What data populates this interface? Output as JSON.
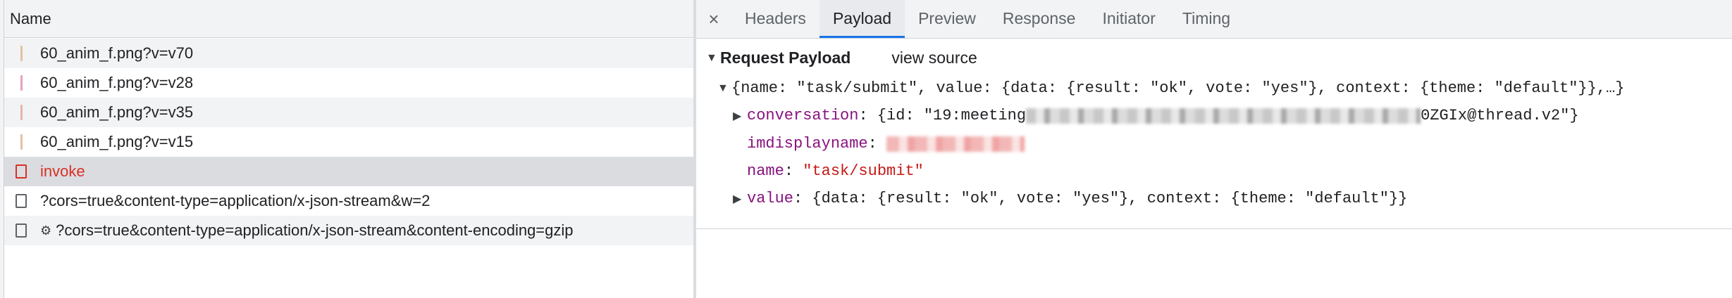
{
  "network": {
    "name_header": "Name",
    "requests": [
      {
        "label": "60_anim_f.png?v=v70",
        "marker": "#e3c2a0",
        "style": "alt"
      },
      {
        "label": "60_anim_f.png?v=v28",
        "marker": "#e4a3c0",
        "style": "plain"
      },
      {
        "label": "60_anim_f.png?v=v35",
        "marker": "#e8b4a6",
        "style": "alt"
      },
      {
        "label": "60_anim_f.png?v=v15",
        "marker": "#e3c2a0",
        "style": "plain"
      },
      {
        "label": "invoke",
        "style": "selected-error"
      },
      {
        "label": "?cors=true&content-type=application/x-json-stream&w=2",
        "style": "plain"
      },
      {
        "label": "?cors=true&content-type=application/x-json-stream&content-encoding=gzip",
        "style": "alt",
        "gear": "⚙"
      }
    ]
  },
  "details": {
    "close_label": "×",
    "tabs": [
      "Headers",
      "Payload",
      "Preview",
      "Response",
      "Initiator",
      "Timing"
    ],
    "active_tab": "Payload",
    "payload": {
      "section_title": "Request Payload",
      "view_source": "view source",
      "summary": "{name: \"task/submit\", value: {data: {result: \"ok\", vote: \"yes\"}, context: {theme: \"default\"}},…}",
      "conversation_key": "conversation",
      "conversation_prefix": "{id: \"19:meeting",
      "conversation_suffix": "0ZGIx@thread.v2\"}",
      "imdisplayname_key": "imdisplayname",
      "name_key": "name",
      "name_value": "\"task/submit\"",
      "value_key": "value",
      "value_value": "{data: {result: \"ok\", vote: \"yes\"}, context: {theme: \"default\"}}"
    }
  },
  "colors": {
    "accent": "#1a73e8",
    "error": "#d93025",
    "key": "#881280",
    "string": "#c41a16"
  }
}
